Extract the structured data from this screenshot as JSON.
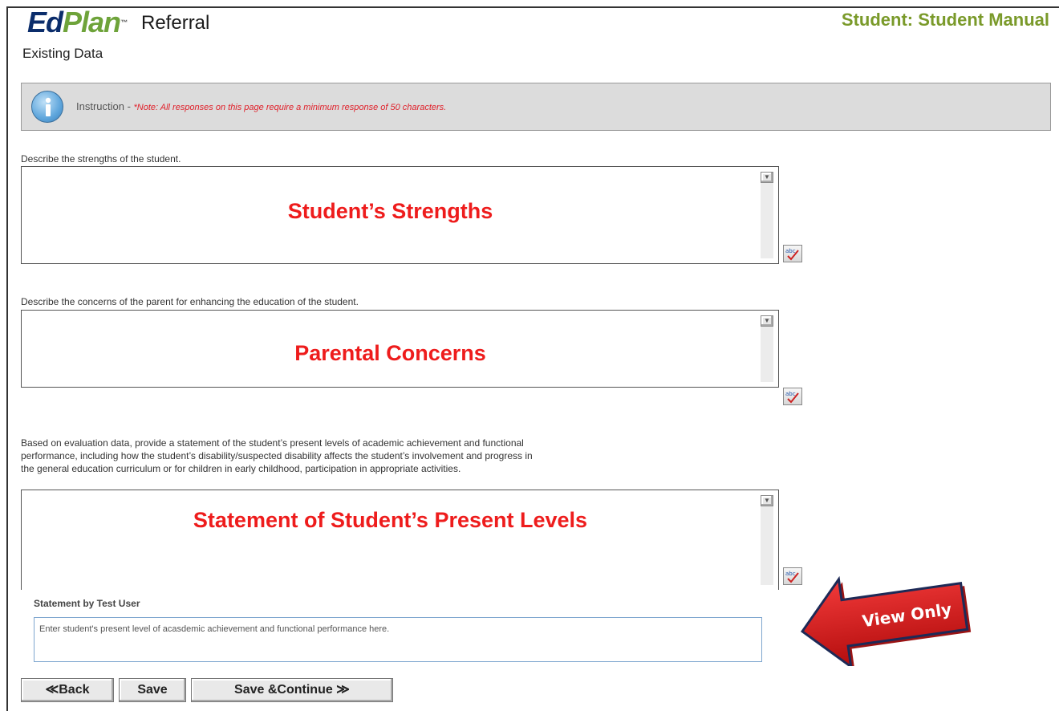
{
  "header": {
    "logo_part1": "Ed",
    "logo_part2": "Plan",
    "module_title": "Referral",
    "subtitle": "Existing Data",
    "student_label": "Student: Student Manual"
  },
  "instruction": {
    "label": "Instruction - ",
    "note": "*Note: All responses on this page require a minimum response of 50 characters."
  },
  "fields": [
    {
      "question": "Describe the strengths of the student.",
      "overlay_text": "Student’s Strengths"
    },
    {
      "question": "Describe the concerns of the parent for enhancing the education of the student.",
      "overlay_text": "Parental Concerns"
    },
    {
      "question_lines": [
        "Based on evaluation data, provide a statement of the student’s present levels of academic achievement and functional",
        "performance, including how the student’s disability/suspected disability affects the student’s involvement and progress in",
        "the general education curriculum or for children in early childhood, participation in appropriate activities."
      ],
      "overlay_text": "Statement of Student’s Present Levels"
    }
  ],
  "statement": {
    "label": "Statement by Test User",
    "value": "Enter student's present level of acasdemic achievement and functional performance here."
  },
  "annotation": {
    "text": "View Only"
  },
  "buttons": {
    "back": "≪Back",
    "save": "Save",
    "save_continue": "Save &Continue ≫"
  },
  "colors": {
    "logo_dark": "#0b2d6b",
    "logo_green": "#6ea33a",
    "student_label": "#7a9a2a",
    "overlay_red": "#ee1c1c",
    "note_red": "#e0202a"
  }
}
